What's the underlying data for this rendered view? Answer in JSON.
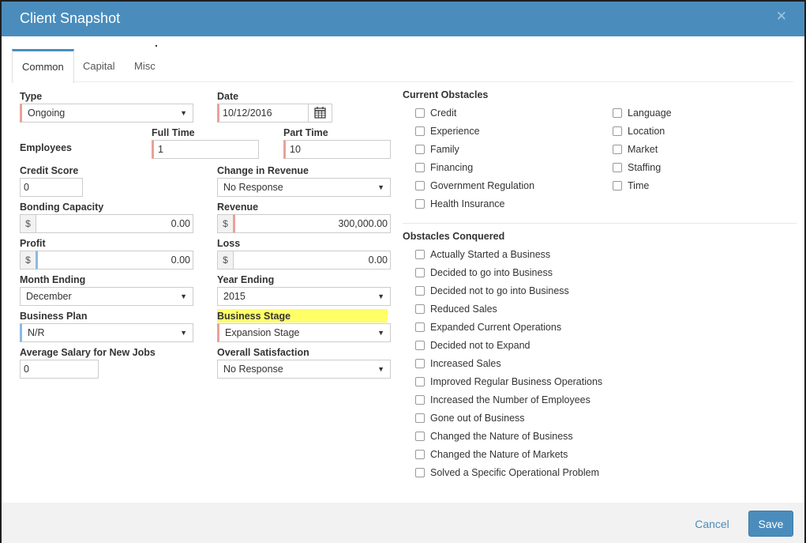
{
  "window": {
    "title": "Client Snapshot"
  },
  "tabs": [
    {
      "label": "Common"
    },
    {
      "label": "Capital"
    },
    {
      "label": "Misc"
    }
  ],
  "form": {
    "type": {
      "label": "Type",
      "value": "Ongoing"
    },
    "date": {
      "label": "Date",
      "value": "10/12/2016"
    },
    "employees": {
      "label": "Employees"
    },
    "full_time": {
      "label": "Full Time",
      "value": "1"
    },
    "part_time": {
      "label": "Part Time",
      "value": "10"
    },
    "credit_score": {
      "label": "Credit Score",
      "value": "0"
    },
    "change_in_revenue": {
      "label": "Change in Revenue",
      "value": "No Response"
    },
    "bonding_capacity": {
      "label": "Bonding Capacity",
      "prefix": "$",
      "value": "0.00"
    },
    "revenue": {
      "label": "Revenue",
      "prefix": "$",
      "value": "300,000.00"
    },
    "profit": {
      "label": "Profit",
      "prefix": "$",
      "value": "0.00"
    },
    "loss": {
      "label": "Loss",
      "prefix": "$",
      "value": "0.00"
    },
    "month_ending": {
      "label": "Month Ending",
      "value": "December"
    },
    "year_ending": {
      "label": "Year Ending",
      "value": "2015"
    },
    "business_plan": {
      "label": "Business Plan",
      "value": "N/R"
    },
    "business_stage": {
      "label": "Business Stage",
      "value": "Expansion Stage"
    },
    "avg_salary": {
      "label": "Average Salary for New Jobs",
      "value": "0"
    },
    "overall_satisfaction": {
      "label": "Overall Satisfaction",
      "value": "No Response"
    }
  },
  "current_obstacles": {
    "title": "Current Obstacles",
    "col1": [
      "Credit",
      "Experience",
      "Family",
      "Financing",
      "Government Regulation",
      "Health Insurance"
    ],
    "col2": [
      "Language",
      "Location",
      "Market",
      "Staffing",
      "Time"
    ]
  },
  "obstacles_conquered": {
    "title": "Obstacles Conquered",
    "items": [
      "Actually Started a Business",
      "Decided to go into Business",
      "Decided not to go into Business",
      "Reduced Sales",
      "Expanded Current Operations",
      "Decided not to Expand",
      "Increased Sales",
      "Improved Regular Business Operations",
      "Increased the Number of Employees",
      "Gone out of Business",
      "Changed the Nature of Business",
      "Changed the Nature of Markets",
      "Solved a Specific Operational Problem"
    ]
  },
  "footer": {
    "cancel_label": "Cancel",
    "save_label": "Save"
  },
  "colors": {
    "header": "#4a8dbd",
    "required_marker": "#e8a29b",
    "highlight": "#ffff66"
  },
  "icons": {
    "close": "close-icon",
    "calendar": "calendar-icon",
    "dropdown": "chevron-down-icon"
  }
}
